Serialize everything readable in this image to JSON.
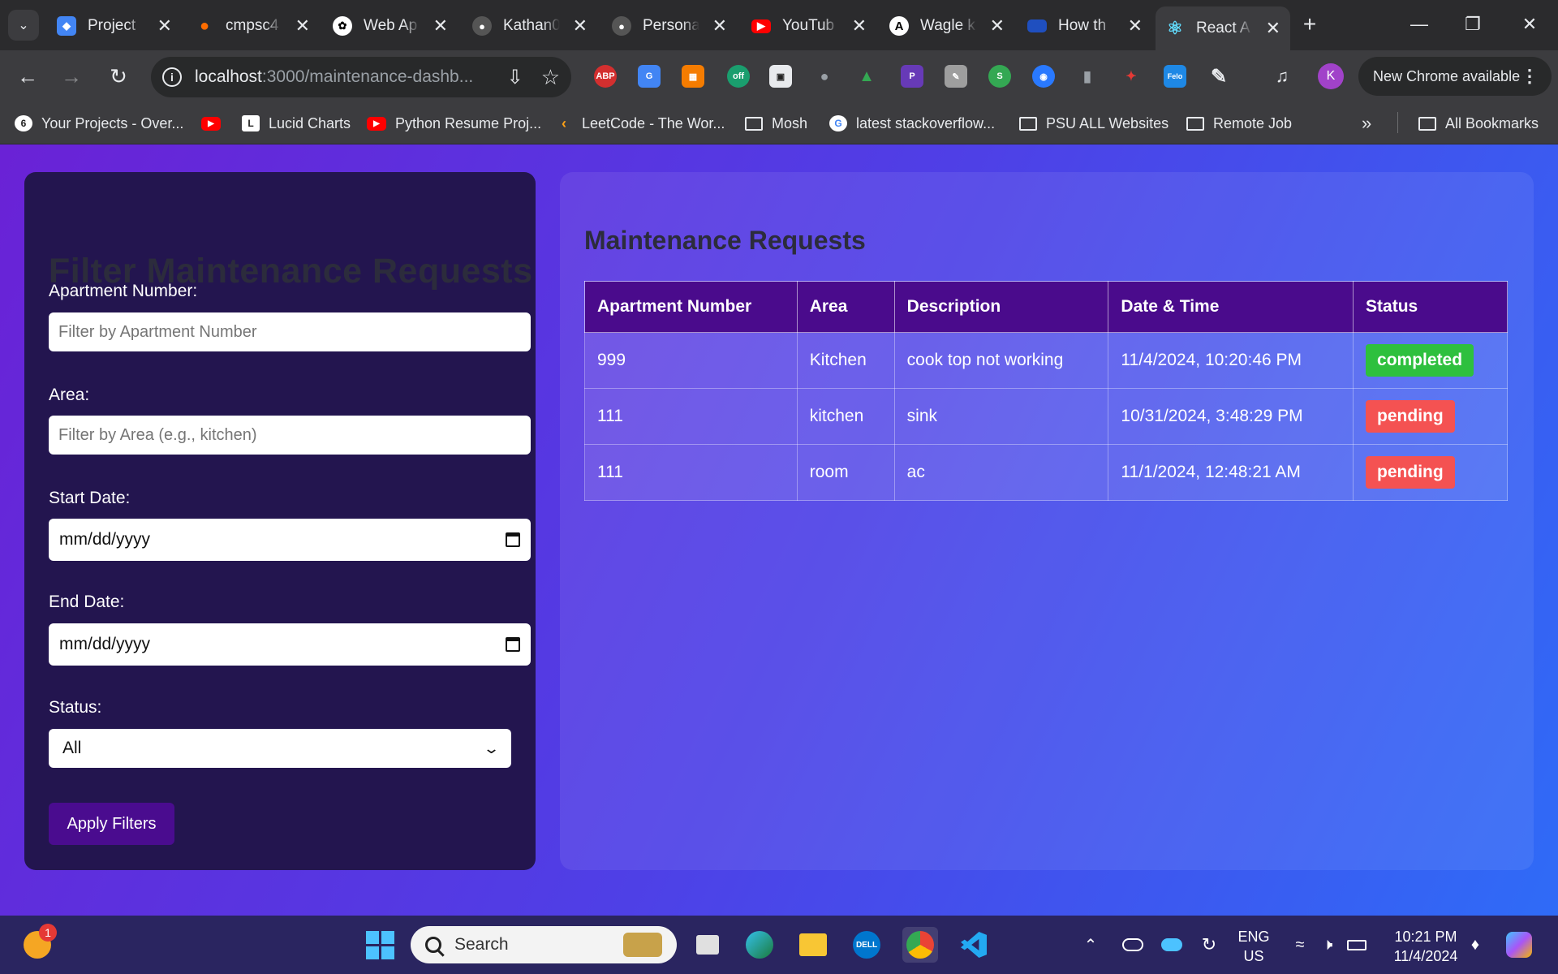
{
  "browser": {
    "tabs": [
      {
        "title": "Project",
        "icon": "project-icon",
        "color": "#4285f4"
      },
      {
        "title": "cmpsc4",
        "icon": "flame-icon",
        "color": "#ff6d00"
      },
      {
        "title": "Web Ap",
        "icon": "openai-icon",
        "color": "#ffffff"
      },
      {
        "title": "Kathan0",
        "icon": "github-icon",
        "color": "#24292e"
      },
      {
        "title": "Persona",
        "icon": "github-icon",
        "color": "#24292e"
      },
      {
        "title": "YouTub",
        "icon": "youtube-icon",
        "color": "#ff0000"
      },
      {
        "title": "Wagle k",
        "icon": "anthropic-icon",
        "color": "#ffffff"
      },
      {
        "title": "How th",
        "icon": "eu-flag-icon",
        "color": "#1f4fbf"
      },
      {
        "title": "React A",
        "icon": "react-icon",
        "color": "#61dafb"
      }
    ],
    "url_host": "localhost",
    "url_path": ":3000/maintenance-dashb...",
    "profile_initial": "K",
    "update_text": "New Chrome available",
    "bookmarks": [
      {
        "label": "Your Projects - Over...",
        "icon": "projects-icon"
      },
      {
        "label": "",
        "icon": "youtube-icon"
      },
      {
        "label": "Lucid Charts",
        "icon": "lucid-icon"
      },
      {
        "label": "Python Resume Proj...",
        "icon": "youtube-icon"
      },
      {
        "label": "LeetCode - The Wor...",
        "icon": "leetcode-icon"
      },
      {
        "label": "Mosh",
        "icon": "folder-icon"
      },
      {
        "label": "latest stackoverflow...",
        "icon": "google-icon"
      },
      {
        "label": "PSU ALL Websites",
        "icon": "folder-icon"
      },
      {
        "label": "Remote Job",
        "icon": "folder-icon"
      }
    ],
    "all_bookmarks": "All Bookmarks"
  },
  "filters": {
    "title": "Filter Maintenance Requests",
    "apartment_label": "Apartment Number:",
    "apartment_placeholder": "Filter by Apartment Number",
    "area_label": "Area:",
    "area_placeholder": "Filter by Area (e.g., kitchen)",
    "start_label": "Start Date:",
    "start_value": "mm/dd/yyyy",
    "end_label": "End Date:",
    "end_value": "mm/dd/yyyy",
    "status_label": "Status:",
    "status_value": "All",
    "apply_label": "Apply Filters"
  },
  "requests": {
    "title": "Maintenance Requests",
    "columns": [
      "Apartment Number",
      "Area",
      "Description",
      "Date & Time",
      "Status"
    ],
    "rows": [
      {
        "apartment": "999",
        "area": "Kitchen",
        "description": "cook top not working",
        "datetime": "11/4/2024, 10:20:46 PM",
        "status": "completed"
      },
      {
        "apartment": "111",
        "area": "kitchen",
        "description": "sink",
        "datetime": "10/31/2024, 3:48:29 PM",
        "status": "pending"
      },
      {
        "apartment": "111",
        "area": "room",
        "description": "ac",
        "datetime": "11/1/2024, 12:48:21 AM",
        "status": "pending"
      }
    ],
    "status_colors": {
      "completed": "#2ec03e",
      "pending": "#f45252"
    }
  },
  "taskbar": {
    "search_label": "Search",
    "weather_badge": "1",
    "lang_top": "ENG",
    "lang_bottom": "US",
    "time": "10:21 PM",
    "date": "11/4/2024"
  }
}
